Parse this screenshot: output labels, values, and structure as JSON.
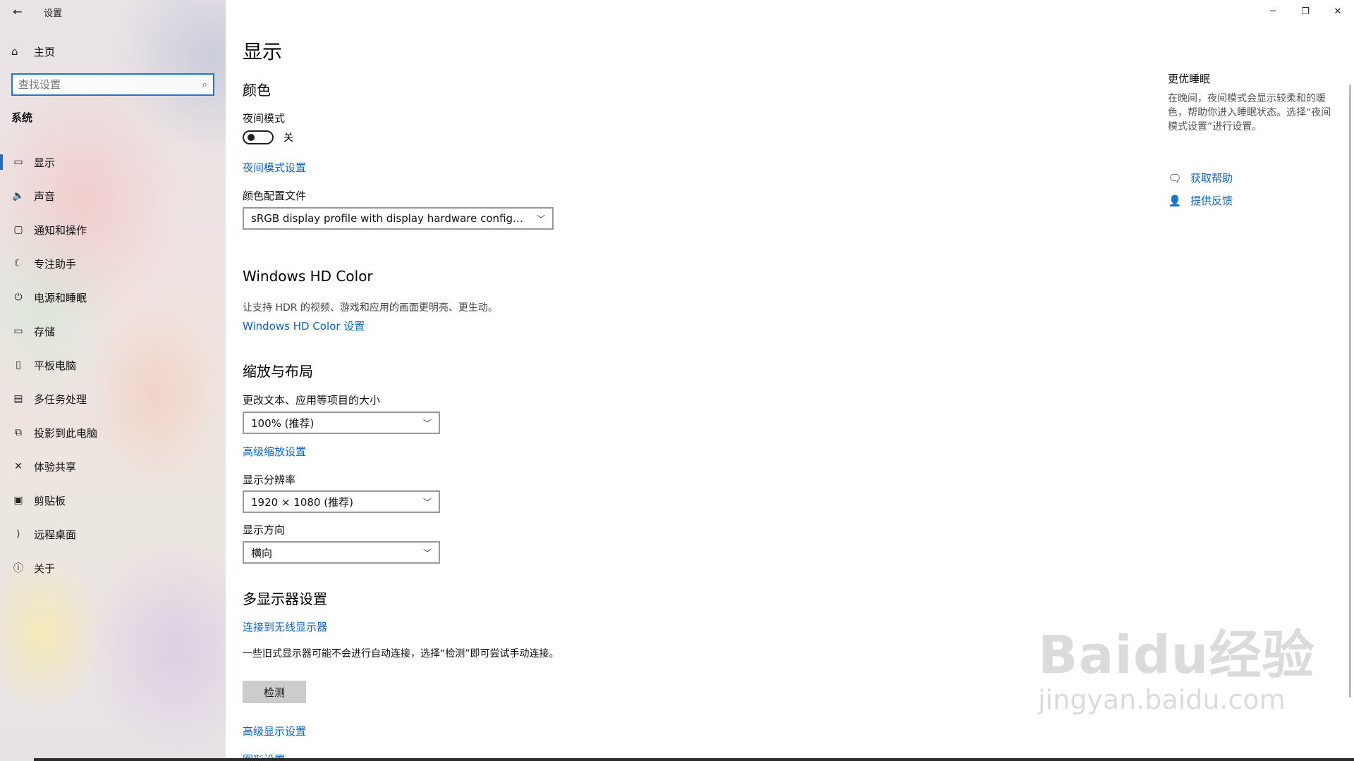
{
  "titlebar": {
    "app_title": "设置",
    "back_icon": "arrow-left-icon",
    "minimize": "─",
    "restore": "❐",
    "close": "✕"
  },
  "sidebar": {
    "home_label": "主页",
    "search_placeholder": "查找设置",
    "section_label": "系统",
    "items": [
      {
        "label": "显示",
        "icon": "display-icon",
        "glyph": "▭"
      },
      {
        "label": "声音",
        "icon": "speaker-icon",
        "glyph": "🔈"
      },
      {
        "label": "通知和操作",
        "icon": "notification-icon",
        "glyph": "▢"
      },
      {
        "label": "专注助手",
        "icon": "moon-icon",
        "glyph": "☾"
      },
      {
        "label": "电源和睡眠",
        "icon": "power-icon",
        "glyph": "⏻"
      },
      {
        "label": "存储",
        "icon": "storage-icon",
        "glyph": "▭"
      },
      {
        "label": "平板电脑",
        "icon": "tablet-icon",
        "glyph": "▯"
      },
      {
        "label": "多任务处理",
        "icon": "multitask-icon",
        "glyph": "▤"
      },
      {
        "label": "投影到此电脑",
        "icon": "project-icon",
        "glyph": "⧉"
      },
      {
        "label": "体验共享",
        "icon": "share-icon",
        "glyph": "✕"
      },
      {
        "label": "剪贴板",
        "icon": "clipboard-icon",
        "glyph": "▣"
      },
      {
        "label": "远程桌面",
        "icon": "remote-desktop-icon",
        "glyph": "⟩"
      },
      {
        "label": "关于",
        "icon": "info-icon",
        "glyph": "ⓘ"
      }
    ],
    "active_index": 0
  },
  "main": {
    "page_title": "显示",
    "color_section": "颜色",
    "night_mode_label": "夜间模式",
    "night_mode_state": "关",
    "night_mode_on": false,
    "night_mode_settings_link": "夜间模式设置",
    "color_profile_label": "颜色配置文件",
    "color_profile_value": "sRGB display profile with display hardware configuration d...",
    "hdr_section": "Windows HD Color",
    "hdr_desc": "让支持 HDR 的视频、游戏和应用的画面更明亮、更生动。",
    "hdr_link": "Windows HD Color 设置",
    "scale_section": "缩放与布局",
    "scale_label": "更改文本、应用等项目的大小",
    "scale_value": "100% (推荐)",
    "advanced_scale_link": "高级缩放设置",
    "resolution_label": "显示分辨率",
    "resolution_value": "1920 × 1080 (推荐)",
    "orientation_label": "显示方向",
    "orientation_value": "横向",
    "multi_display_section": "多显示器设置",
    "wireless_link": "连接到无线显示器",
    "multi_desc": "一些旧式显示器可能不会进行自动连接，选择“检测”即可尝试手动连接。",
    "detect_button": "检测",
    "advanced_display_link": "高级显示设置",
    "graphics_link": "图形设置"
  },
  "right_panel": {
    "title": "更优睡眠",
    "desc": "在晚间，夜间模式会显示较柔和的暖色，帮助你进入睡眠状态。选择“夜间模式设置”进行设置。",
    "help_link": "获取帮助",
    "feedback_link": "提供反馈"
  },
  "watermark": {
    "main": "Baidu经验",
    "sub": "jingyan.baidu.com"
  },
  "colors": {
    "accent": "#0b64c5",
    "active_indicator": "#2a6cc5"
  }
}
